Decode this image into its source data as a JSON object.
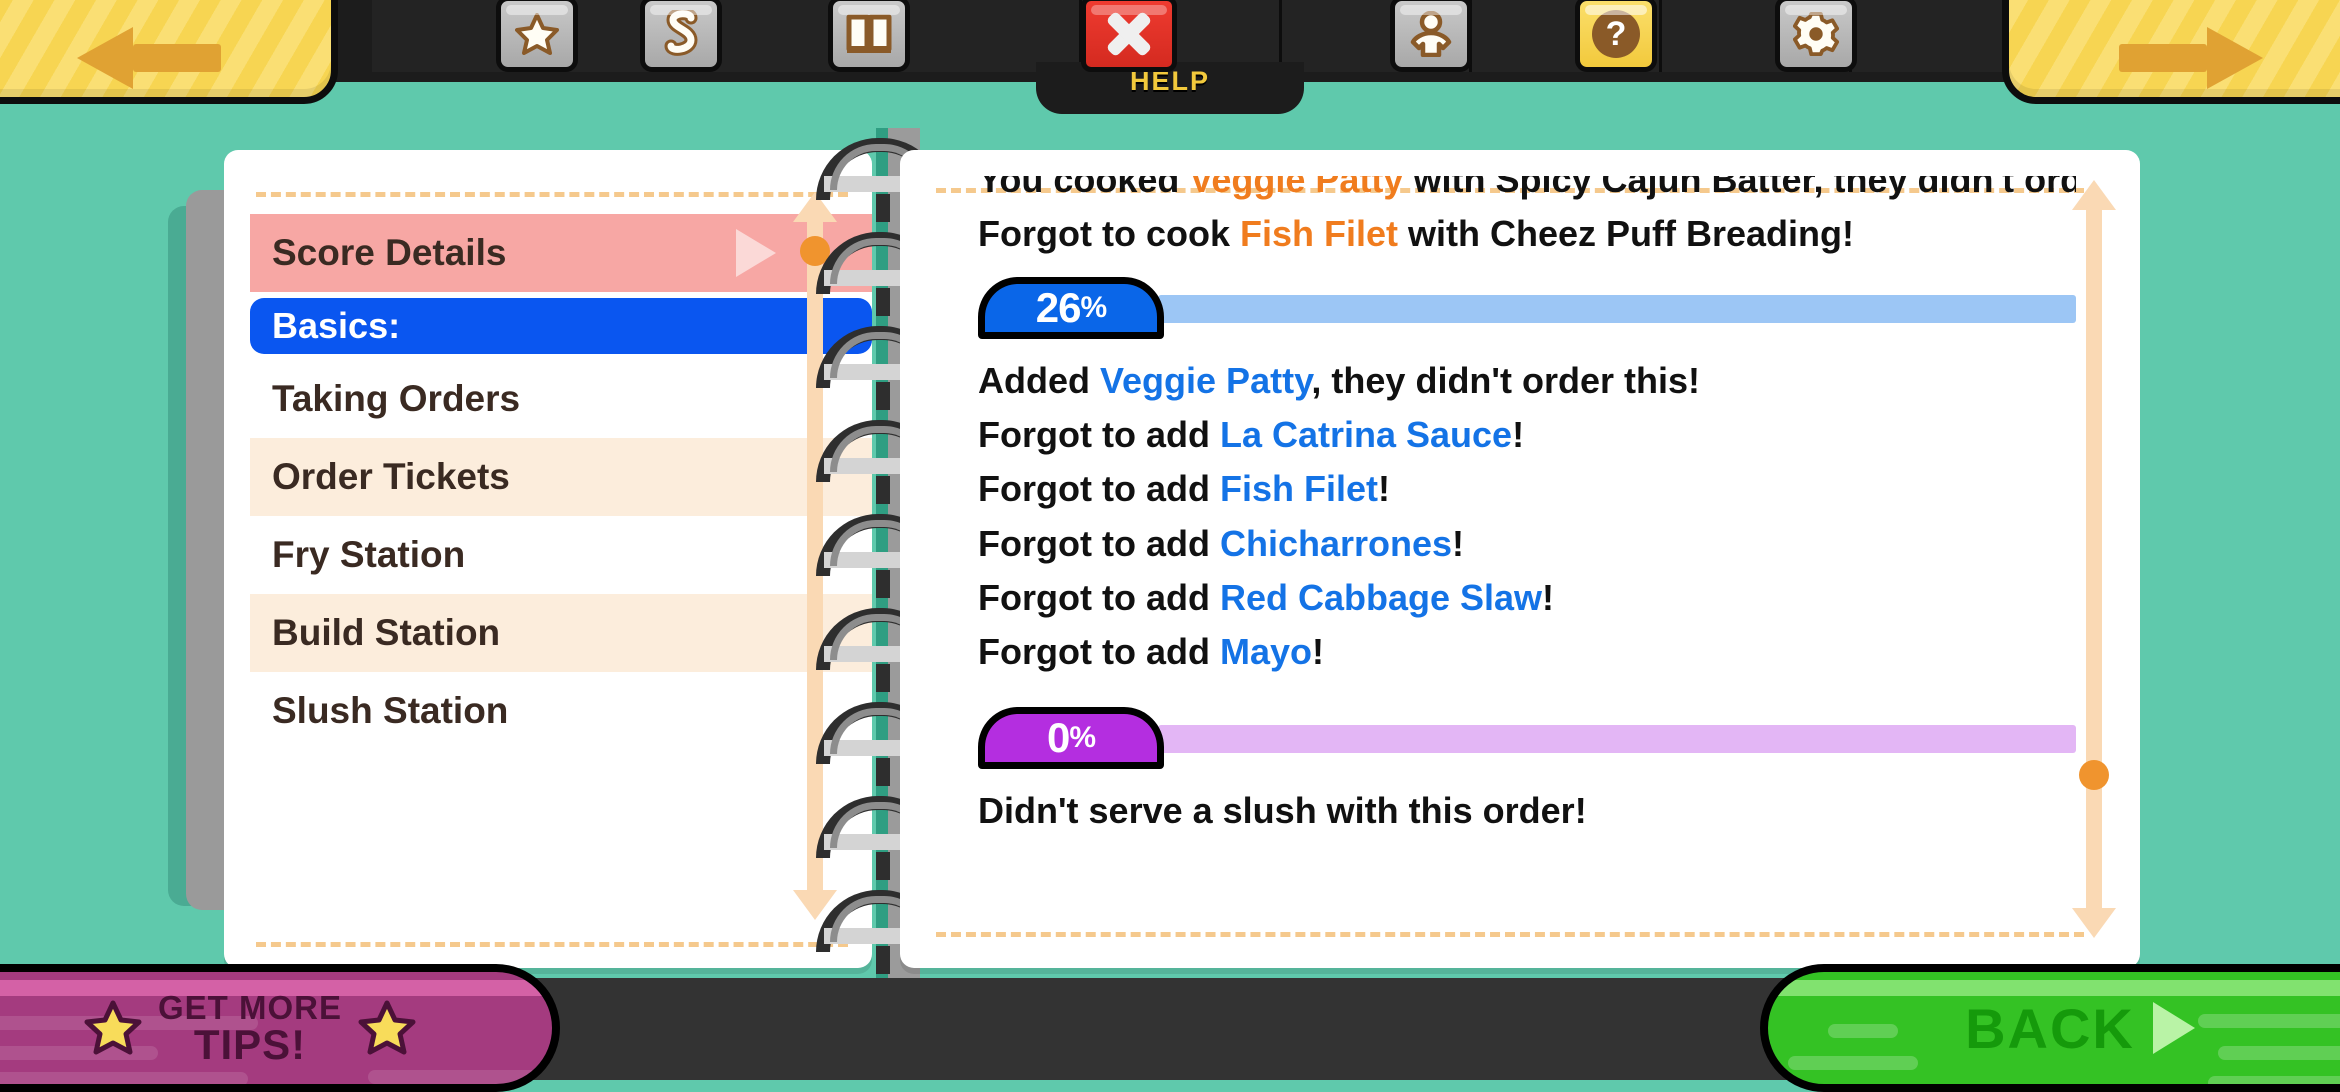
{
  "topbar": {
    "nav_prev": "previous-arrow",
    "nav_next": "next-arrow",
    "help_label": "HELP",
    "buttons": [
      {
        "name": "star-button",
        "icon": "star-icon"
      },
      {
        "name": "sauce-button",
        "icon": "s-squiggle-icon"
      },
      {
        "name": "recipe-book-button",
        "icon": "open-book-icon"
      },
      {
        "name": "close-button",
        "icon": "x-close-icon"
      },
      {
        "name": "customer-button",
        "icon": "person-icon"
      },
      {
        "name": "help-button",
        "icon": "question-mark-icon"
      },
      {
        "name": "settings-button",
        "icon": "gear-icon"
      }
    ]
  },
  "sidebar": {
    "items": [
      {
        "label": "Score Details",
        "style": "pink",
        "has_arrow": true
      },
      {
        "label": "Basics:",
        "style": "blue",
        "has_arrow": false
      },
      {
        "label": "Taking Orders",
        "style": "white",
        "has_arrow": false
      },
      {
        "label": "Order Tickets",
        "style": "cream",
        "has_arrow": false
      },
      {
        "label": "Fry Station",
        "style": "white",
        "has_arrow": false
      },
      {
        "label": "Build Station",
        "style": "cream",
        "has_arrow": false
      },
      {
        "label": "Slush Station",
        "style": "white",
        "has_arrow": false
      }
    ]
  },
  "content": {
    "top_lines": [
      {
        "parts": [
          {
            "text": "You cooked ",
            "color": "black"
          },
          {
            "text": "Veggie Patty",
            "color": "orange"
          },
          {
            "text": " with Spicy Cajun Batter, they didn't order this!",
            "color": "black"
          }
        ]
      },
      {
        "parts": [
          {
            "text": "Forgot to cook ",
            "color": "black"
          },
          {
            "text": "Fish Filet",
            "color": "orange"
          },
          {
            "text": " with Cheez Puff Breading!",
            "color": "black"
          }
        ]
      }
    ],
    "sections": [
      {
        "score": "26",
        "percent_symbol": "%",
        "badge_color": "#0a66e8",
        "bar_color": "#9cc6f5",
        "lines": [
          {
            "parts": [
              {
                "text": "Added ",
                "color": "black"
              },
              {
                "text": "Veggie Patty",
                "color": "blue"
              },
              {
                "text": ", they didn't order this!",
                "color": "black"
              }
            ]
          },
          {
            "parts": [
              {
                "text": "Forgot to add ",
                "color": "black"
              },
              {
                "text": "La Catrina Sauce",
                "color": "blue"
              },
              {
                "text": "!",
                "color": "black"
              }
            ]
          },
          {
            "parts": [
              {
                "text": "Forgot to add ",
                "color": "black"
              },
              {
                "text": "Fish Filet",
                "color": "blue"
              },
              {
                "text": "!",
                "color": "black"
              }
            ]
          },
          {
            "parts": [
              {
                "text": "Forgot to add ",
                "color": "black"
              },
              {
                "text": "Chicharrones",
                "color": "blue"
              },
              {
                "text": "!",
                "color": "black"
              }
            ]
          },
          {
            "parts": [
              {
                "text": "Forgot to add ",
                "color": "black"
              },
              {
                "text": "Red Cabbage Slaw",
                "color": "blue"
              },
              {
                "text": "!",
                "color": "black"
              }
            ]
          },
          {
            "parts": [
              {
                "text": "Forgot to add ",
                "color": "black"
              },
              {
                "text": "Mayo",
                "color": "blue"
              },
              {
                "text": "!",
                "color": "black"
              }
            ]
          }
        ]
      },
      {
        "score": "0",
        "percent_symbol": "%",
        "badge_color": "#b42ee0",
        "bar_color": "#e3b6f5",
        "lines": [
          {
            "parts": [
              {
                "text": "Didn't serve a slush with this order!",
                "color": "black"
              }
            ]
          }
        ]
      }
    ]
  },
  "bottombar": {
    "tips_line1": "GET MORE",
    "tips_line2": "TIPS!",
    "back_label": "BACK"
  },
  "colors": {
    "background_teal": "#5fc9ac",
    "orange_text": "#f07c1e",
    "blue_text": "#1473e6",
    "scroll_accent": "#f0942e",
    "scroll_track": "#fad9b4",
    "dashed_rule": "#f5c98d"
  }
}
